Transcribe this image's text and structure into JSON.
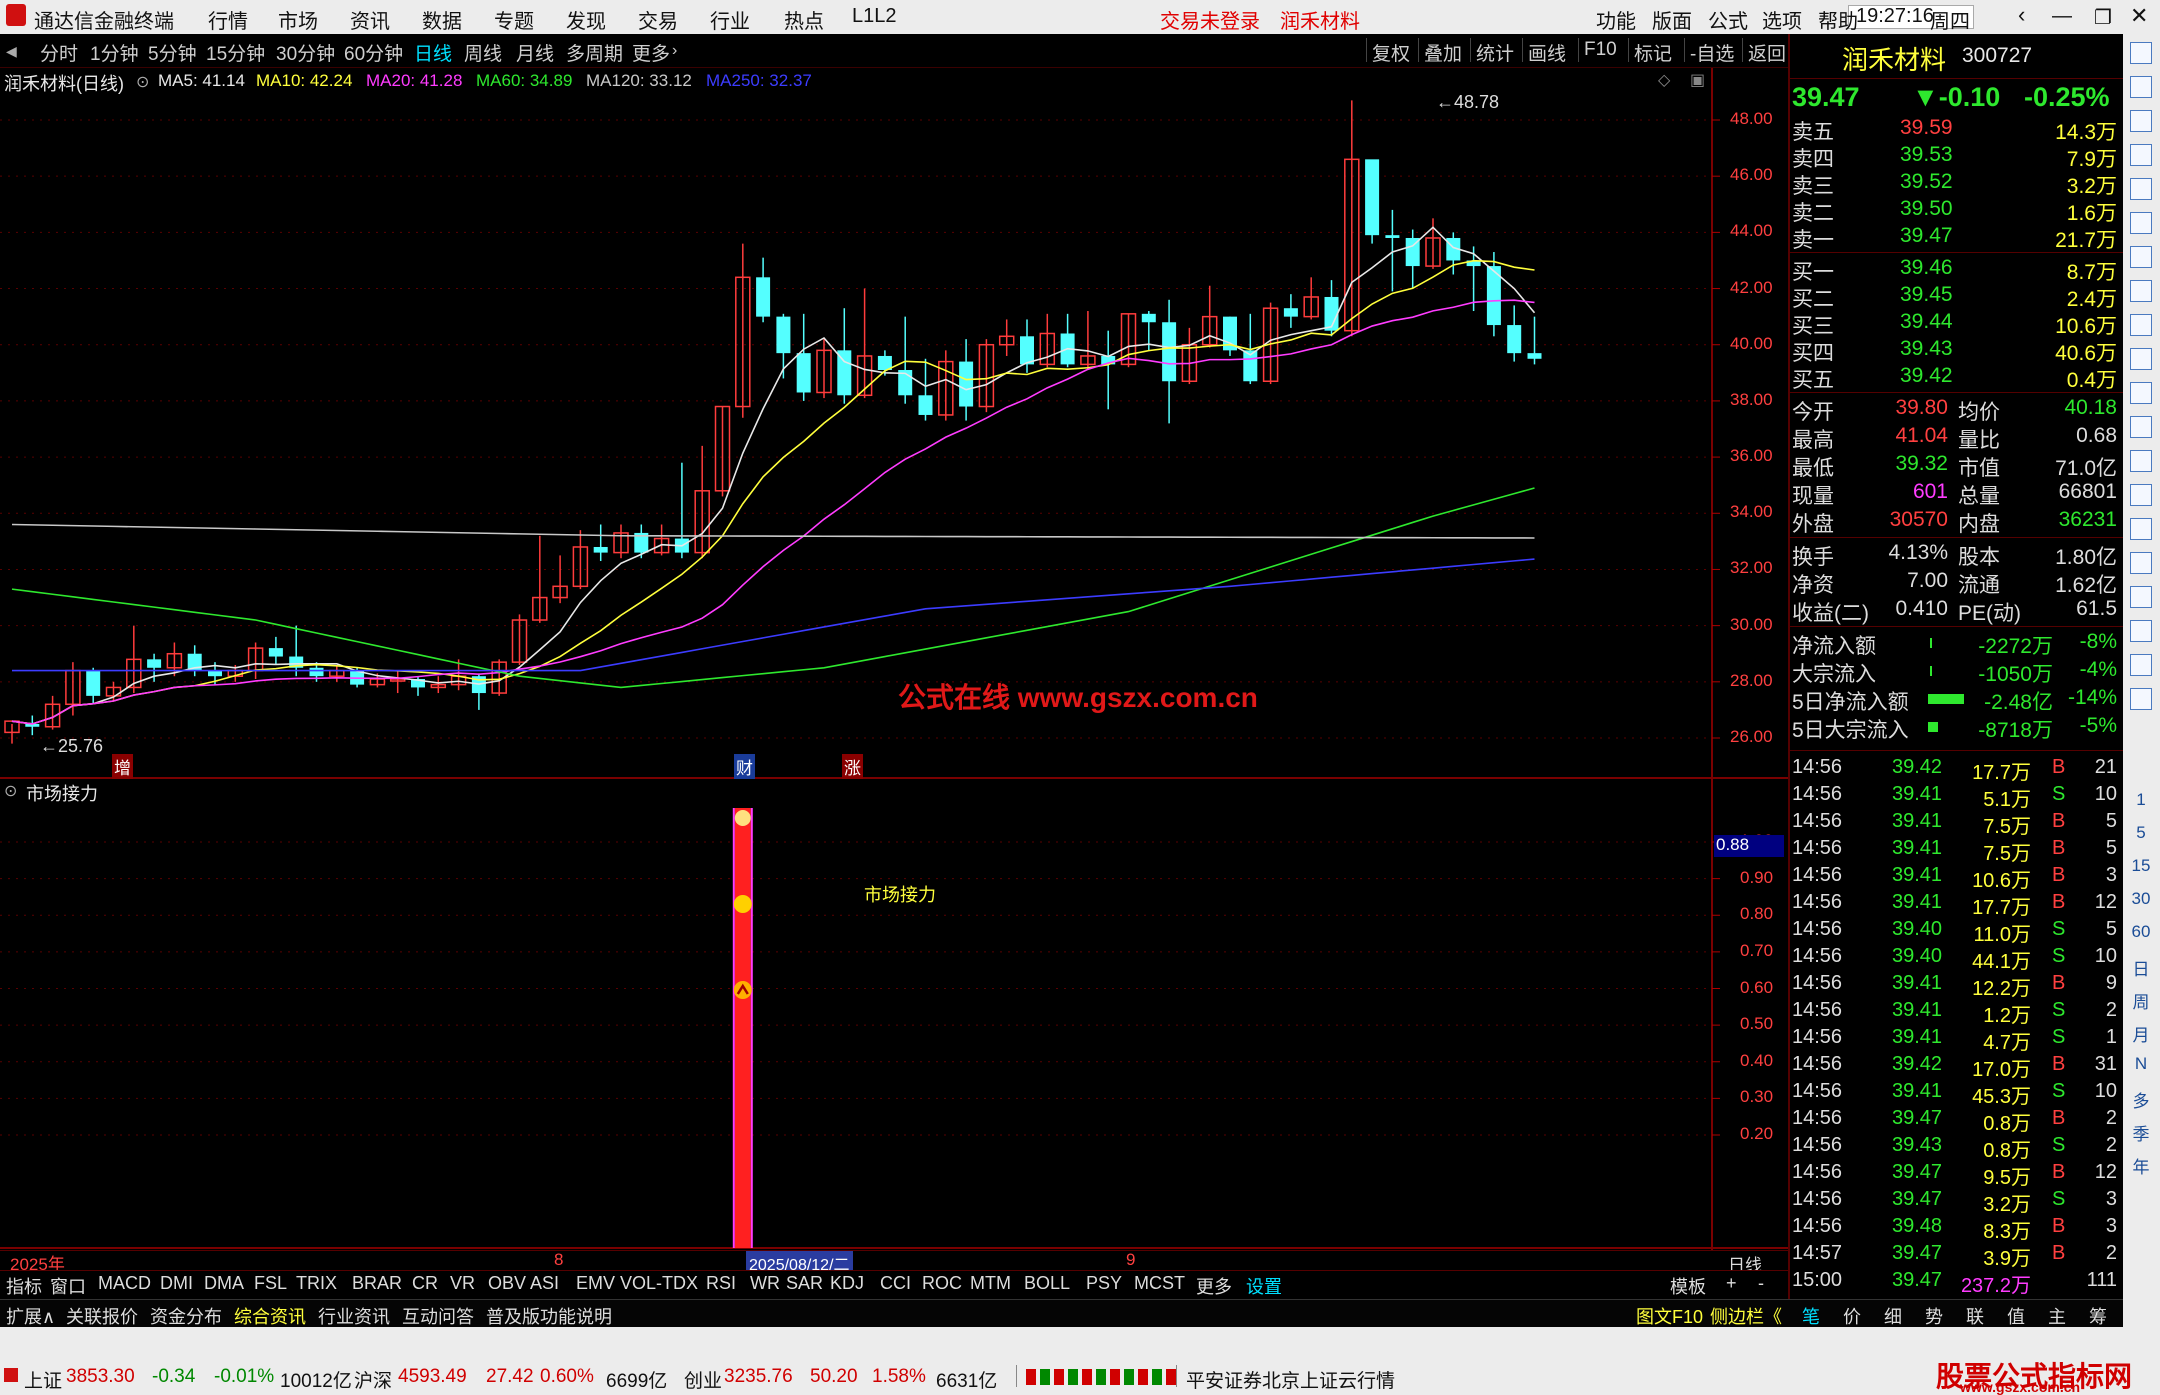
{
  "menubar": {
    "app_title": "通达信金融终端",
    "menu": [
      "行情",
      "市场",
      "资讯",
      "数据",
      "专题",
      "发现",
      "交易",
      "行业",
      "热点",
      "L1L2"
    ],
    "login_status": "交易未登录",
    "stock_name": "润禾材料",
    "right_menu": [
      "功能",
      "版面",
      "公式",
      "选项",
      "帮助"
    ],
    "time": "19:27:16",
    "weekday": "周四"
  },
  "periods": [
    "分时",
    "1分钟",
    "5分钟",
    "15分钟",
    "30分钟",
    "60分钟",
    "日线",
    "周线",
    "月线",
    "多周期",
    "更多"
  ],
  "toolbar": [
    "复权",
    "叠加",
    "统计",
    "画线",
    "F10",
    "标记",
    "-自选",
    "返回"
  ],
  "chart_header": {
    "name": "润禾材料(日线)",
    "ma": [
      {
        "label": "MA5: 41.14",
        "color": "#e8e8e8"
      },
      {
        "label": "MA10: 42.24",
        "color": "#ffff3c"
      },
      {
        "label": "MA20: 41.28",
        "color": "#ff3cff"
      },
      {
        "label": "MA60: 34.89",
        "color": "#2ee82e"
      },
      {
        "label": "MA120: 33.12",
        "color": "#c8c8c8"
      },
      {
        "label": "MA250: 32.37",
        "color": "#3c3cff"
      }
    ]
  },
  "price_axis": [
    "48.00",
    "46.00",
    "44.00",
    "42.00",
    "40.00",
    "38.00",
    "36.00",
    "34.00",
    "32.00",
    "30.00",
    "28.00",
    "26.00"
  ],
  "annotations": {
    "high": "48.78",
    "low": "25.76",
    "watermark": "公式在线  www.gszx.com.cn",
    "markers": [
      "增",
      "财",
      "涨"
    ]
  },
  "subchart": {
    "title": "市场接力",
    "label": "市场接力",
    "axis": [
      "1.00",
      "0.90",
      "0.80",
      "0.70",
      "0.60",
      "0.50",
      "0.40",
      "0.30",
      "0.20"
    ],
    "current": "0.88"
  },
  "date_axis": {
    "year": "2025年",
    "m8": "8",
    "cursor_date": "2025/08/12/二",
    "m9": "9",
    "period": "日线"
  },
  "indicator_tabs": [
    "指标",
    "窗口",
    "MACD",
    "DMI",
    "DMA",
    "FSL",
    "TRIX",
    "BRAR",
    "CR",
    "VR",
    "OBV",
    "ASI",
    "EMV",
    "VOL-TDX",
    "RSI",
    "WR",
    "SAR",
    "KDJ",
    "CCI",
    "ROC",
    "MTM",
    "BOLL",
    "PSY",
    "MCST",
    "更多",
    "设置"
  ],
  "indicator_right": [
    "模板",
    "+",
    "-"
  ],
  "info_tabs": [
    "扩展∧",
    "关联报价",
    "资金分布",
    "综合资讯",
    "行业资讯",
    "互动问答",
    "普及版功能说明"
  ],
  "info_right": [
    "图文F10",
    "侧边栏《"
  ],
  "right_tabs": [
    "笔",
    "价",
    "细",
    "势",
    "联",
    "值",
    "主",
    "筹"
  ],
  "quote": {
    "name": "润禾材料",
    "code": "300727",
    "price": "39.47",
    "change": "▼-0.10",
    "pct": "-0.25%",
    "asks": [
      {
        "l": "卖五",
        "p": "39.59",
        "v": "14.3万"
      },
      {
        "l": "卖四",
        "p": "39.53",
        "v": "7.9万"
      },
      {
        "l": "卖三",
        "p": "39.52",
        "v": "3.2万"
      },
      {
        "l": "卖二",
        "p": "39.50",
        "v": "1.6万"
      },
      {
        "l": "卖一",
        "p": "39.47",
        "v": "21.7万"
      }
    ],
    "bids": [
      {
        "l": "买一",
        "p": "39.46",
        "v": "8.7万"
      },
      {
        "l": "买二",
        "p": "39.45",
        "v": "2.4万"
      },
      {
        "l": "买三",
        "p": "39.44",
        "v": "10.6万"
      },
      {
        "l": "买四",
        "p": "39.43",
        "v": "40.6万"
      },
      {
        "l": "买五",
        "p": "39.42",
        "v": "0.4万"
      }
    ],
    "stats1": [
      [
        "今开",
        "39.80",
        "均价",
        "40.18"
      ],
      [
        "最高",
        "41.04",
        "量比",
        "0.68"
      ],
      [
        "最低",
        "39.32",
        "市值",
        "71.0亿"
      ],
      [
        "现量",
        "601",
        "总量",
        "66801"
      ],
      [
        "外盘",
        "30570",
        "内盘",
        "36231"
      ]
    ],
    "stats2": [
      [
        "换手",
        "4.13%",
        "股本",
        "1.80亿"
      ],
      [
        "净资",
        "7.00",
        "流通",
        "1.62亿"
      ],
      [
        "收益(二)",
        "0.410",
        "PE(动)",
        "61.5"
      ]
    ],
    "flows": [
      [
        "净流入额",
        "-2272万",
        "-8%"
      ],
      [
        "大宗流入",
        "-1050万",
        "-4%"
      ],
      [
        "5日净流入额",
        "-2.48亿",
        "-14%"
      ],
      [
        "5日大宗流入",
        "-8718万",
        "-5%"
      ]
    ]
  },
  "ticks": [
    [
      "14:56",
      "39.42",
      "17.7万",
      "B",
      "21"
    ],
    [
      "14:56",
      "39.41",
      "5.1万",
      "S",
      "10"
    ],
    [
      "14:56",
      "39.41",
      "7.5万",
      "B",
      "5"
    ],
    [
      "14:56",
      "39.41",
      "7.5万",
      "B",
      "5"
    ],
    [
      "14:56",
      "39.41",
      "10.6万",
      "B",
      "3"
    ],
    [
      "14:56",
      "39.41",
      "17.7万",
      "B",
      "12"
    ],
    [
      "14:56",
      "39.40",
      "11.0万",
      "S",
      "5"
    ],
    [
      "14:56",
      "39.40",
      "44.1万",
      "S",
      "10"
    ],
    [
      "14:56",
      "39.41",
      "12.2万",
      "B",
      "9"
    ],
    [
      "14:56",
      "39.41",
      "1.2万",
      "S",
      "2"
    ],
    [
      "14:56",
      "39.41",
      "4.7万",
      "S",
      "1"
    ],
    [
      "14:56",
      "39.42",
      "17.0万",
      "B",
      "31"
    ],
    [
      "14:56",
      "39.41",
      "45.3万",
      "S",
      "10"
    ],
    [
      "14:56",
      "39.47",
      "0.8万",
      "B",
      "2"
    ],
    [
      "14:56",
      "39.43",
      "0.8万",
      "S",
      "2"
    ],
    [
      "14:56",
      "39.47",
      "9.5万",
      "B",
      "12"
    ],
    [
      "14:56",
      "39.47",
      "3.2万",
      "S",
      "3"
    ],
    [
      "14:56",
      "39.48",
      "8.3万",
      "B",
      "3"
    ],
    [
      "14:57",
      "39.47",
      "3.9万",
      "B",
      "2"
    ],
    [
      "15:00",
      "39.47",
      "237.2万",
      "",
      "111"
    ]
  ],
  "sidebar_letters": [
    "1",
    "5",
    "15",
    "30",
    "60",
    "日",
    "周",
    "月",
    "N",
    "多",
    "季",
    "年"
  ],
  "status": {
    "sh_name": "上证",
    "sh": "3853.30",
    "sh_chg": "-0.34",
    "sh_pct": "-0.01%",
    "sh_amt": "10012亿",
    "sz_name": "沪深",
    "sz": "4593.49",
    "sz_chg": "27.42",
    "sz_pct": "0.60%",
    "sz_amt": "6699亿",
    "cy_name": "创业",
    "cy": "3235.76",
    "cy_chg": "50.20",
    "cy_pct": "1.58%",
    "cy_amt": "6631亿",
    "broker": "平安证券北京上证云行情",
    "logo": "股票公式指标网",
    "logo_url": "www.gszx.com.cn"
  },
  "candles": [
    [
      26.2,
      26.6,
      25.8,
      26.5
    ],
    [
      26.5,
      26.4,
      26.1,
      26.8
    ],
    [
      26.4,
      27.2,
      26.3,
      27.5
    ],
    [
      27.2,
      28.4,
      26.8,
      28.7
    ],
    [
      28.4,
      27.5,
      27.2,
      28.5
    ],
    [
      27.5,
      27.8,
      27.3,
      28.0
    ],
    [
      27.8,
      28.8,
      27.6,
      30.0
    ],
    [
      28.8,
      28.5,
      28.0,
      29.0
    ],
    [
      28.5,
      29.0,
      28.2,
      29.4
    ],
    [
      29.0,
      28.4,
      28.2,
      29.3
    ],
    [
      28.4,
      28.2,
      27.9,
      28.7
    ],
    [
      28.2,
      28.4,
      28.0,
      28.6
    ],
    [
      28.4,
      29.2,
      28.1,
      29.4
    ],
    [
      29.2,
      28.9,
      28.6,
      29.6
    ],
    [
      28.9,
      28.5,
      28.2,
      30.0
    ],
    [
      28.5,
      28.2,
      28.0,
      28.7
    ],
    [
      28.2,
      28.4,
      28.0,
      28.6
    ],
    [
      28.4,
      27.9,
      27.8,
      28.5
    ],
    [
      27.9,
      28.1,
      27.8,
      28.3
    ],
    [
      28.1,
      28.1,
      27.6,
      28.4
    ],
    [
      28.1,
      27.8,
      27.5,
      28.2
    ],
    [
      27.8,
      27.9,
      27.6,
      28.2
    ],
    [
      27.9,
      28.2,
      27.7,
      28.8
    ],
    [
      28.2,
      27.6,
      27.0,
      28.3
    ],
    [
      27.6,
      28.7,
      27.5,
      28.8
    ],
    [
      28.7,
      30.2,
      28.6,
      30.4
    ],
    [
      30.2,
      31.0,
      30.1,
      33.2
    ],
    [
      31.0,
      31.4,
      30.8,
      32.5
    ],
    [
      31.4,
      32.8,
      31.3,
      33.4
    ],
    [
      32.8,
      32.6,
      32.3,
      33.6
    ],
    [
      32.6,
      33.3,
      32.4,
      33.6
    ],
    [
      33.3,
      32.6,
      32.4,
      33.6
    ],
    [
      32.6,
      33.1,
      32.5,
      33.6
    ],
    [
      33.1,
      32.6,
      32.4,
      35.8
    ],
    [
      32.6,
      34.8,
      32.4,
      36.4
    ],
    [
      34.8,
      37.8,
      34.6,
      37.8
    ],
    [
      37.8,
      42.4,
      37.4,
      43.6
    ],
    [
      42.4,
      41.0,
      40.8,
      43.1
    ],
    [
      41.0,
      39.7,
      38.8,
      41.1
    ],
    [
      39.7,
      38.3,
      38.0,
      41.1
    ],
    [
      38.3,
      39.8,
      38.1,
      40.2
    ],
    [
      39.8,
      38.2,
      37.9,
      41.3
    ],
    [
      38.2,
      39.6,
      38.1,
      42.0
    ],
    [
      39.6,
      39.1,
      38.9,
      39.8
    ],
    [
      39.1,
      38.2,
      37.9,
      41.0
    ],
    [
      38.2,
      37.5,
      37.3,
      39.5
    ],
    [
      37.5,
      39.4,
      37.3,
      39.8
    ],
    [
      39.4,
      37.8,
      37.3,
      40.2
    ],
    [
      37.8,
      40.0,
      37.6,
      40.2
    ],
    [
      40.0,
      40.3,
      39.6,
      40.9
    ],
    [
      40.3,
      39.3,
      39.0,
      40.9
    ],
    [
      39.3,
      40.4,
      39.2,
      41.1
    ],
    [
      40.4,
      39.3,
      39.2,
      41.1
    ],
    [
      39.3,
      39.6,
      39.1,
      41.2
    ],
    [
      39.6,
      39.3,
      37.7,
      40.5
    ],
    [
      39.3,
      41.1,
      39.2,
      41.1
    ],
    [
      41.1,
      40.8,
      39.8,
      41.2
    ],
    [
      40.8,
      38.7,
      37.2,
      41.6
    ],
    [
      38.7,
      40.0,
      38.6,
      40.6
    ],
    [
      40.0,
      41.0,
      39.9,
      42.1
    ],
    [
      41.0,
      39.8,
      39.6,
      41.0
    ],
    [
      39.8,
      38.7,
      38.6,
      41.1
    ],
    [
      38.7,
      41.3,
      38.6,
      41.5
    ],
    [
      41.3,
      41.0,
      40.6,
      41.8
    ],
    [
      41.0,
      41.7,
      40.9,
      42.4
    ],
    [
      41.7,
      40.5,
      40.3,
      42.3
    ],
    [
      40.5,
      46.6,
      40.3,
      48.7
    ],
    [
      46.6,
      43.9,
      43.6,
      46.4
    ],
    [
      43.9,
      43.8,
      41.9,
      44.8
    ],
    [
      43.8,
      42.8,
      42.0,
      44.1
    ],
    [
      42.8,
      43.8,
      42.7,
      44.5
    ],
    [
      43.8,
      43.0,
      42.5,
      44.0
    ],
    [
      43.0,
      42.8,
      41.2,
      43.5
    ],
    [
      42.8,
      40.7,
      40.3,
      43.3
    ],
    [
      40.7,
      39.7,
      39.4,
      41.4
    ],
    [
      39.7,
      39.5,
      39.3,
      41.0
    ]
  ]
}
